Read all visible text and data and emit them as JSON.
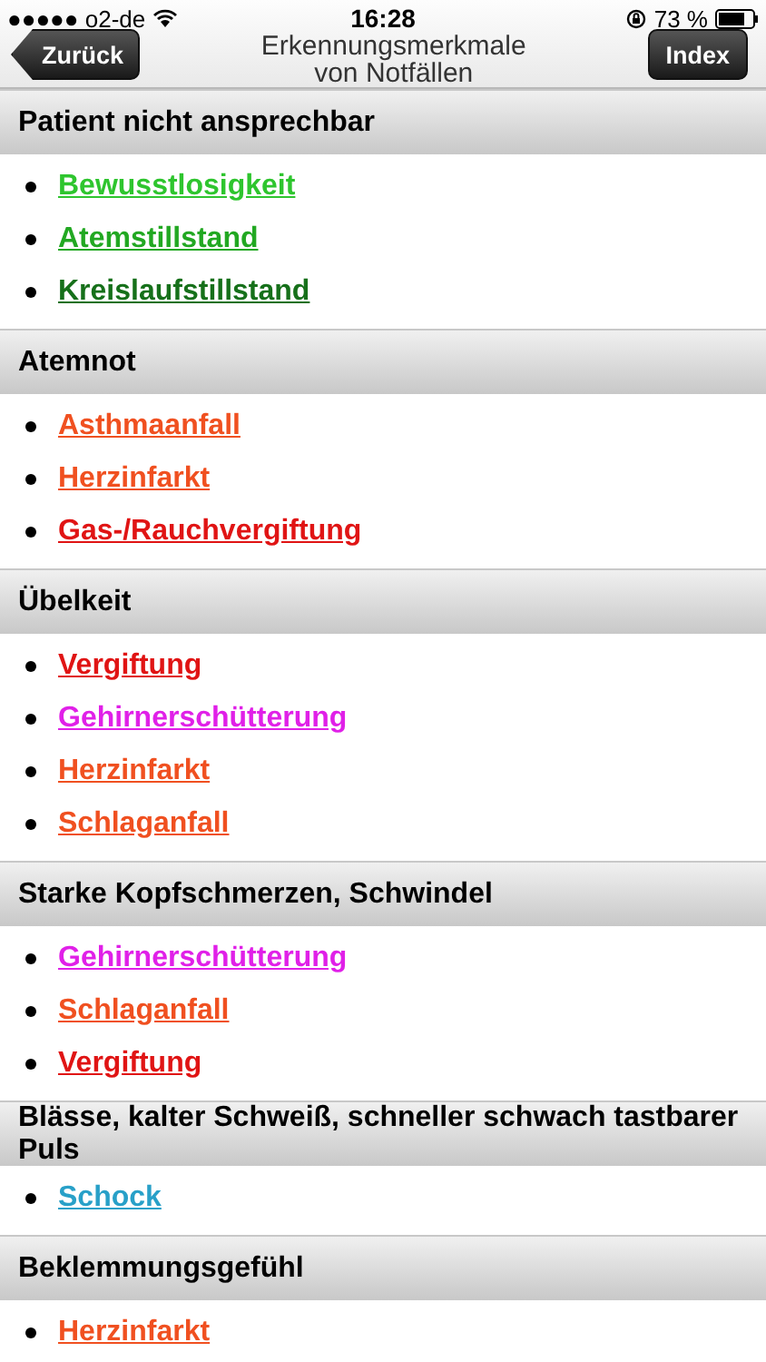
{
  "status_bar": {
    "carrier": "●●●●● o2-de",
    "time": "16:28",
    "battery": "73 %"
  },
  "nav_bar": {
    "back": "Zurück",
    "title": "Erkennungsmerkmale von Notfällen",
    "index": "Index"
  },
  "sections": [
    {
      "title": "Patient nicht ansprechbar",
      "items": [
        {
          "label": "Bewusstlosigkeit",
          "color": "#2ec52e"
        },
        {
          "label": "Atemstillstand",
          "color": "#22a822"
        },
        {
          "label": "Kreislaufstillstand",
          "color": "#16701a"
        }
      ]
    },
    {
      "title": "Atemnot",
      "items": [
        {
          "label": "Asthmaanfall",
          "color": "#f05020"
        },
        {
          "label": "Herzinfarkt",
          "color": "#f05020"
        },
        {
          "label": "Gas-/Rauchvergiftung",
          "color": "#e01414"
        }
      ]
    },
    {
      "title": "Übelkeit",
      "items": [
        {
          "label": "Vergiftung",
          "color": "#e01414"
        },
        {
          "label": "Gehirnerschütterung",
          "color": "#e020e8"
        },
        {
          "label": "Herzinfarkt",
          "color": "#f05020"
        },
        {
          "label": "Schlaganfall",
          "color": "#f05020"
        }
      ]
    },
    {
      "title": "Starke Kopfschmerzen, Schwindel",
      "items": [
        {
          "label": "Gehirnerschütterung",
          "color": "#e020e8"
        },
        {
          "label": "Schlaganfall",
          "color": "#f05020"
        },
        {
          "label": "Vergiftung",
          "color": "#e01414"
        }
      ]
    },
    {
      "title": "Blässe, kalter Schweiß, schneller schwach tastbarer Puls",
      "items": [
        {
          "label": "Schock",
          "color": "#28a0c8"
        }
      ]
    },
    {
      "title": "Beklemmungsgefühl",
      "items": [
        {
          "label": "Herzinfarkt",
          "color": "#f05020"
        }
      ]
    }
  ]
}
